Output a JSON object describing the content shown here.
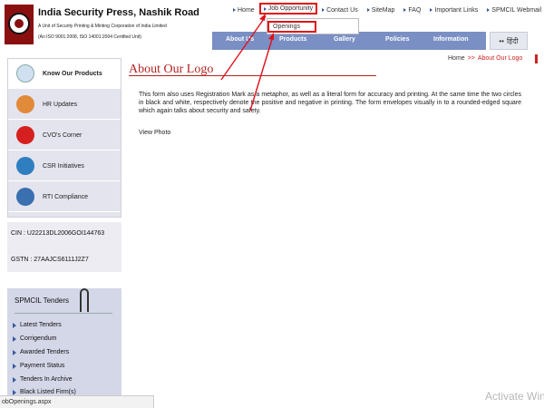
{
  "header": {
    "org_name": "India Security Press, Nashik Road",
    "subtitle1": "A Unit of Security Printing & Minting Corporation of India Limited",
    "subtitle2": "(An ISO 9001:2008, ISO 14001:2004 Certified Unit)"
  },
  "top_nav": [
    "Home",
    "Job Opportunity",
    "Contact Us",
    "SiteMap",
    "FAQ",
    "Important Links",
    "SPMCIL Webmail"
  ],
  "dropdown": {
    "option": "Openings"
  },
  "main_nav": [
    "About Us",
    "Products",
    "Gallery",
    "Policies",
    "Information"
  ],
  "language": "हिंदी",
  "breadcrumb": {
    "home": "Home",
    "separator": ">>",
    "current": "About Our Logo"
  },
  "page": {
    "title": "About Our Logo",
    "body": "This form also uses Registration Mark as a metaphor, as well as a literal form for accuracy and printing. At the same time the two circles in black and white, respectively denote the positive and negative in printing. The form envelopes visually in to a rounded-edged square which again talks about security and safety.",
    "link": "View Photo"
  },
  "sidebar": {
    "items": [
      {
        "label": "Know Our Products",
        "icon": "search-icon",
        "color": "#d0e0f0"
      },
      {
        "label": "HR Updates",
        "icon": "people-icon",
        "color": "#e08a3a"
      },
      {
        "label": "CVO's Corner",
        "icon": "magnifier-icon",
        "color": "#d62020"
      },
      {
        "label": "CSR Initiatives",
        "icon": "globe-icon",
        "color": "#2f7fc0"
      },
      {
        "label": "RTI Compliance",
        "icon": "rti-icon",
        "color": "#3a6fb0"
      }
    ]
  },
  "company_info": {
    "cin": "CIN : U22213DL2006GOI144763",
    "gstn": "GSTN : 27AAJCS6111J2Z7"
  },
  "tenders": {
    "heading": "SPMCIL Tenders",
    "items": [
      "Latest Tenders",
      "Corrigendum",
      "Awarded Tenders",
      "Payment Status",
      "Tenders In Archive",
      "Black Listed Firm(s)"
    ]
  },
  "status_bar": "obOpenings.aspx",
  "watermark": "Activate Win",
  "colors": {
    "accent_red": "#e0101a",
    "nav_blue": "#7a8fc4",
    "title_red": "#b22222"
  }
}
